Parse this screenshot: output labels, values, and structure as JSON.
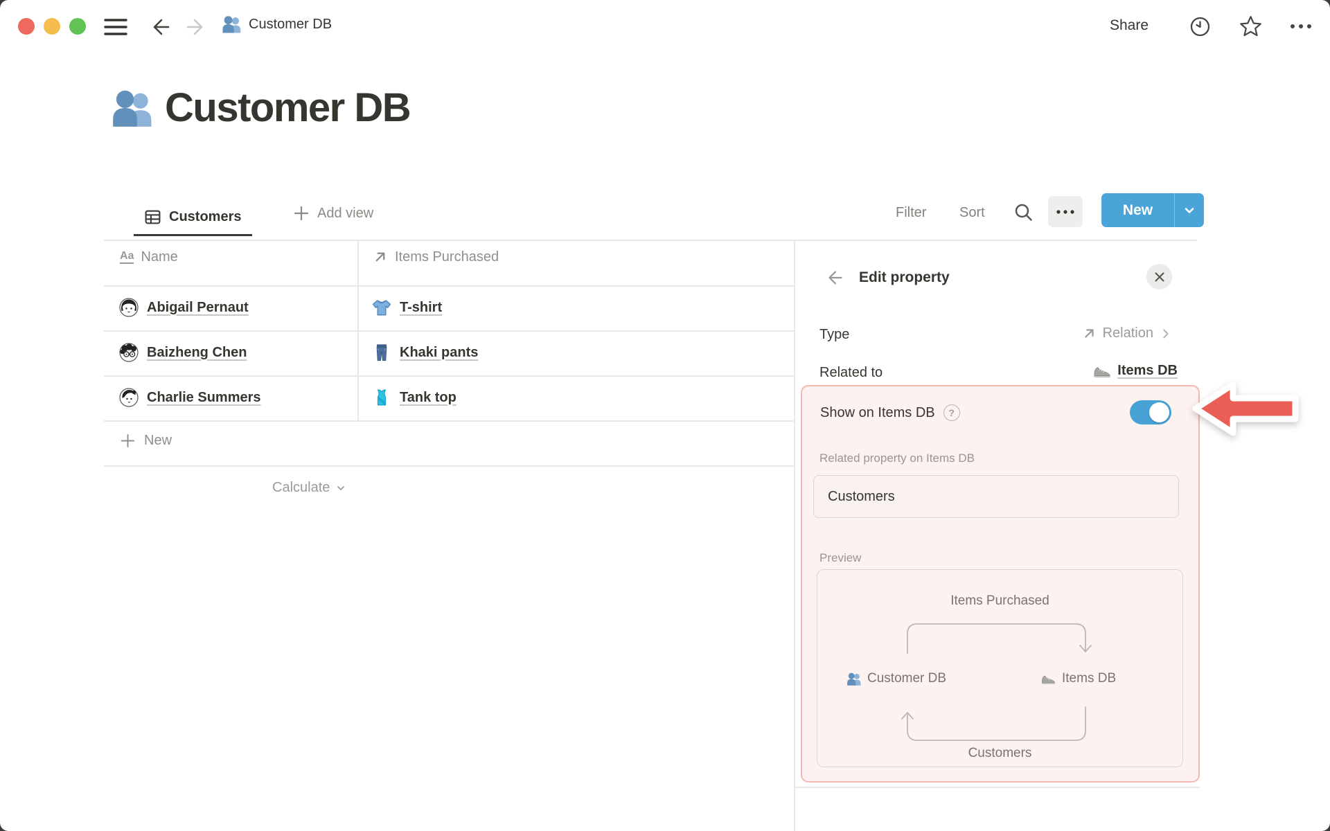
{
  "window": {
    "breadcrumb": "Customer DB",
    "traffic_lights": [
      "close",
      "minimize",
      "zoom"
    ],
    "left_icons": [
      "hamburger-menu-icon",
      "back-arrow-icon",
      "forward-arrow-icon",
      "people-icon"
    ],
    "share_label": "Share",
    "right_icons": [
      "clock-icon",
      "star-icon",
      "ellipsis-icon"
    ]
  },
  "page": {
    "icon": "people-icon",
    "title": "Customer DB"
  },
  "toolbar": {
    "tab_label": "Customers",
    "tab_icon": "table-view-icon",
    "add_view_label": "Add view",
    "filter_label": "Filter",
    "sort_label": "Sort",
    "search_icon": "magnifier-icon",
    "more_icon": "ellipsis-icon",
    "new_label": "New"
  },
  "table": {
    "columns": [
      {
        "name": "Name",
        "icon": "text-property-icon",
        "icon_glyph": "Aa"
      },
      {
        "name": "Items Purchased",
        "icon": "relation-arrow-icon"
      }
    ],
    "rows": [
      {
        "name": "Abigail Pernaut",
        "avatar": "abigail-avatar",
        "item": "T-shirt",
        "item_icon": "t-shirt-icon"
      },
      {
        "name": "Baizheng Chen",
        "avatar": "baizheng-avatar",
        "item": "Khaki pants",
        "item_icon": "jeans-icon"
      },
      {
        "name": "Charlie Summers",
        "avatar": "charlie-avatar",
        "item": "Tank top",
        "item_icon": "tank-top-icon"
      }
    ],
    "new_row_label": "New",
    "calculate_label": "Calculate"
  },
  "panel": {
    "title": "Edit property",
    "type_label": "Type",
    "type_value": "Relation",
    "type_icon": "relation-arrow-icon",
    "related_to_label": "Related to",
    "related_to_value": "Items DB",
    "related_to_icon": "running-shoe-icon",
    "show_on_label": "Show on Items DB",
    "help_glyph": "?",
    "toggle_state": "on",
    "related_property_label": "Related property on Items DB",
    "related_property_value": "Customers",
    "preview_label": "Preview",
    "preview": {
      "top_label": "Items Purchased",
      "left_node": "Customer DB",
      "left_node_icon": "people-icon",
      "right_node": "Items DB",
      "right_node_icon": "running-shoe-icon",
      "bottom_label": "Customers"
    },
    "annotation": "red-arrow-pointing-left-at-toggle"
  },
  "colors": {
    "text_dark": "#37352f",
    "text_gray": "#8f8e8a",
    "accent_blue": "#4aa4d8",
    "toggle_blue": "#48a2d6",
    "highlight_bg": "#fdf2ef",
    "highlight_border": "#f3b9b1",
    "annotation_red": "#ea5f55",
    "traffic_red": "#ee6a5f",
    "traffic_yellow": "#f5bd4c",
    "traffic_green": "#61c354"
  }
}
